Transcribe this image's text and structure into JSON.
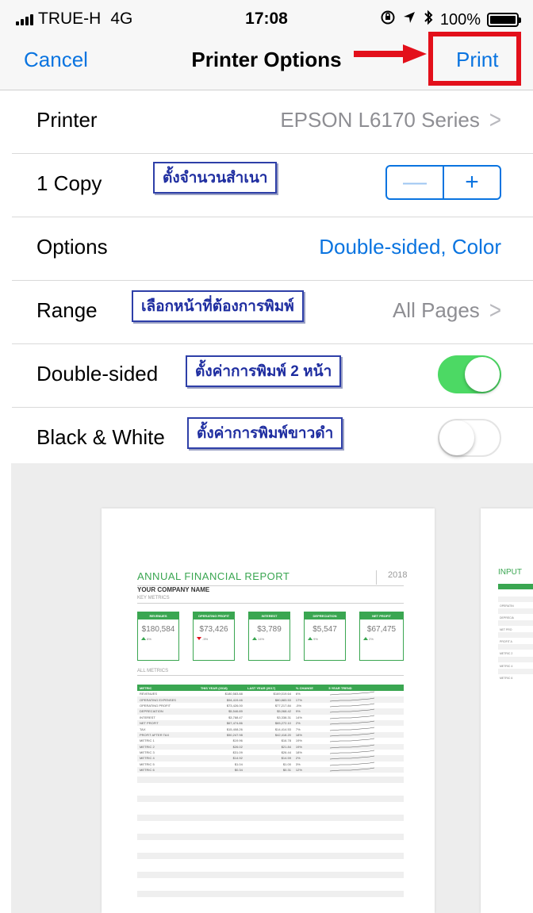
{
  "status_bar": {
    "carrier": "TRUE-H",
    "network": "4G",
    "time": "17:08",
    "battery": "100%",
    "icons": [
      "signal-icon",
      "lock-rotation-icon",
      "location-icon",
      "bluetooth-icon",
      "battery-icon"
    ]
  },
  "nav": {
    "cancel": "Cancel",
    "title": "Printer Options",
    "print": "Print"
  },
  "rows": {
    "printer": {
      "label": "Printer",
      "value": "EPSON L6170 Series"
    },
    "copies": {
      "label": "1 Copy",
      "minus": "—",
      "plus": "+"
    },
    "options": {
      "label": "Options",
      "value": "Double-sided, Color"
    },
    "range": {
      "label": "Range",
      "value": "All Pages"
    },
    "double_sided": {
      "label": "Double-sided",
      "on": true
    },
    "black_white": {
      "label": "Black & White",
      "on": false
    }
  },
  "annotations": {
    "copies": "ตั้งจำนวนสำเนา",
    "range": "เลือกหน้าที่ต้องการพิมพ์",
    "double_sided": "ตั้งค่าการพิมพ์ 2 หน้า",
    "black_white": "ตั้งค่าการพิมพ์ขาวดำ"
  },
  "colors": {
    "accent": "#0a74e0",
    "toggle_on": "#4cd964",
    "highlight": "#e3101b",
    "annotation": "#1e2da0",
    "report_green": "#3aa651"
  },
  "preview": {
    "page1": {
      "title": "ANNUAL FINANCIAL REPORT",
      "year": "2018",
      "company": "YOUR COMPANY NAME",
      "key_metrics": "KEY METRICS",
      "all_metrics": "ALL METRICS",
      "cards": [
        {
          "head": "REVENUES",
          "value": "$180,584",
          "change": "6%",
          "dir": "up"
        },
        {
          "head": "OPERATING PROFIT",
          "value": "$73,426",
          "change": "-5%",
          "dir": "down"
        },
        {
          "head": "INTEREST",
          "value": "$3,789",
          "change": "14%",
          "dir": "up"
        },
        {
          "head": "DEPRECIATION",
          "value": "$5,547",
          "change": "9%",
          "dir": "up"
        },
        {
          "head": "NET PROFIT",
          "value": "$67,475",
          "change": "2%",
          "dir": "up"
        }
      ],
      "table_headers": [
        "METRIC",
        "THIS YEAR (2018)",
        "LAST YEAR (2017)",
        "% CHANGE",
        "5 YEAR TREND"
      ],
      "table_rows": [
        [
          "REVENUES",
          "$180,583.88",
          "$169,019.64",
          "6%"
        ],
        [
          "OPERATING EXPENSES",
          "$94,419.46",
          "$80,883.53",
          "17%"
        ],
        [
          "OPERATING PROFIT",
          "$73,426.00",
          "$77,217.84",
          "-5%"
        ],
        [
          "DEPRECIATION",
          "$5,546.89",
          "$5,068.42",
          "9%"
        ],
        [
          "INTEREST",
          "$3,788.47",
          "$3,338.31",
          "14%"
        ],
        [
          "NET PROFIT",
          "$67,474.86",
          "$65,272.10",
          "2%"
        ],
        [
          "TAX",
          "$15,408.26",
          "$14,414.53",
          "7%"
        ],
        [
          "PROFIT AFTER TAX",
          "$50,247.98",
          "$42,418.20",
          "18%"
        ],
        [
          "METRIC 1",
          "$19.96",
          "$16.78",
          "19%"
        ],
        [
          "METRIC 2",
          "$26.02",
          "$21.84",
          "19%"
        ],
        [
          "METRIC 3",
          "$31.09",
          "$26.44",
          "18%"
        ],
        [
          "METRIC 4",
          "$14.92",
          "$14.59",
          "2%"
        ],
        [
          "METRIC 5",
          "$1.04",
          "$1.00",
          "3%"
        ],
        [
          "METRIC 6",
          "$0.34",
          "$0.31",
          "12%"
        ]
      ]
    },
    "page2": {
      "title": "INPUT",
      "rows": [
        "REVENUE",
        "OPERATIN",
        "OPERATIN",
        "DEPRECIA",
        "INTEREST",
        "NET PRO",
        "TAX",
        "PROFIT A",
        "METRIC 1",
        "METRIC 2",
        "METRIC 3",
        "METRIC 4",
        "METRIC 5",
        "METRIC 6"
      ]
    }
  }
}
